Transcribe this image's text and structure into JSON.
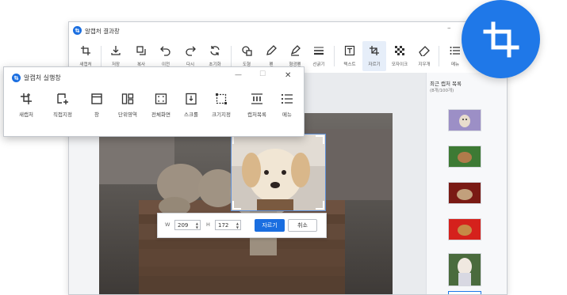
{
  "result_window": {
    "title": "알캡처 결과창",
    "minimize": "–",
    "toolbar": [
      {
        "label": "새캡처",
        "icon": "new-capture-icon"
      },
      {
        "label": "저장",
        "icon": "save-icon"
      },
      {
        "label": "복사",
        "icon": "copy-icon"
      },
      {
        "label": "이전",
        "icon": "undo-icon"
      },
      {
        "label": "다시",
        "icon": "redo-icon"
      },
      {
        "label": "초기화",
        "icon": "reset-icon"
      },
      {
        "label": "도형",
        "icon": "shape-icon"
      },
      {
        "label": "펜",
        "icon": "pen-icon"
      },
      {
        "label": "형광펜",
        "icon": "highlighter-icon"
      },
      {
        "label": "선굵기",
        "icon": "line-width-icon"
      },
      {
        "label": "텍스트",
        "icon": "text-icon"
      },
      {
        "label": "자르기",
        "icon": "crop-icon"
      },
      {
        "label": "모자이크",
        "icon": "mosaic-icon"
      },
      {
        "label": "지우개",
        "icon": "eraser-icon"
      },
      {
        "label": "메뉴",
        "icon": "menu-icon"
      }
    ],
    "recent_panel": {
      "title": "최근 캡처 목록",
      "subtitle": "(8개/100개)"
    }
  },
  "launcher": {
    "title": "알캡처 실행창",
    "controls": {
      "minimize": "—",
      "maximize": "☐",
      "close": "✕"
    },
    "tools": [
      {
        "label": "새캡처",
        "icon": "new-capture-icon"
      },
      {
        "label": "직접지정",
        "icon": "direct-select-icon"
      },
      {
        "label": "창",
        "icon": "window-icon"
      },
      {
        "label": "단위영역",
        "icon": "unit-area-icon"
      },
      {
        "label": "전체화면",
        "icon": "fullscreen-icon"
      },
      {
        "label": "스크롤",
        "icon": "scroll-icon"
      },
      {
        "label": "크기지정",
        "icon": "size-select-icon"
      },
      {
        "label": "캡처목록",
        "icon": "capture-list-icon"
      },
      {
        "label": "메뉴",
        "icon": "menu-icon"
      }
    ]
  },
  "crop_bar": {
    "w_label": "W",
    "w_value": "209",
    "h_label": "H",
    "h_value": "172",
    "crop_button": "자르기",
    "cancel_button": "취소"
  },
  "colors": {
    "brand": "#1f78e8",
    "crop_button": "#1a6ee0",
    "active_tool": "#e6eef9"
  }
}
